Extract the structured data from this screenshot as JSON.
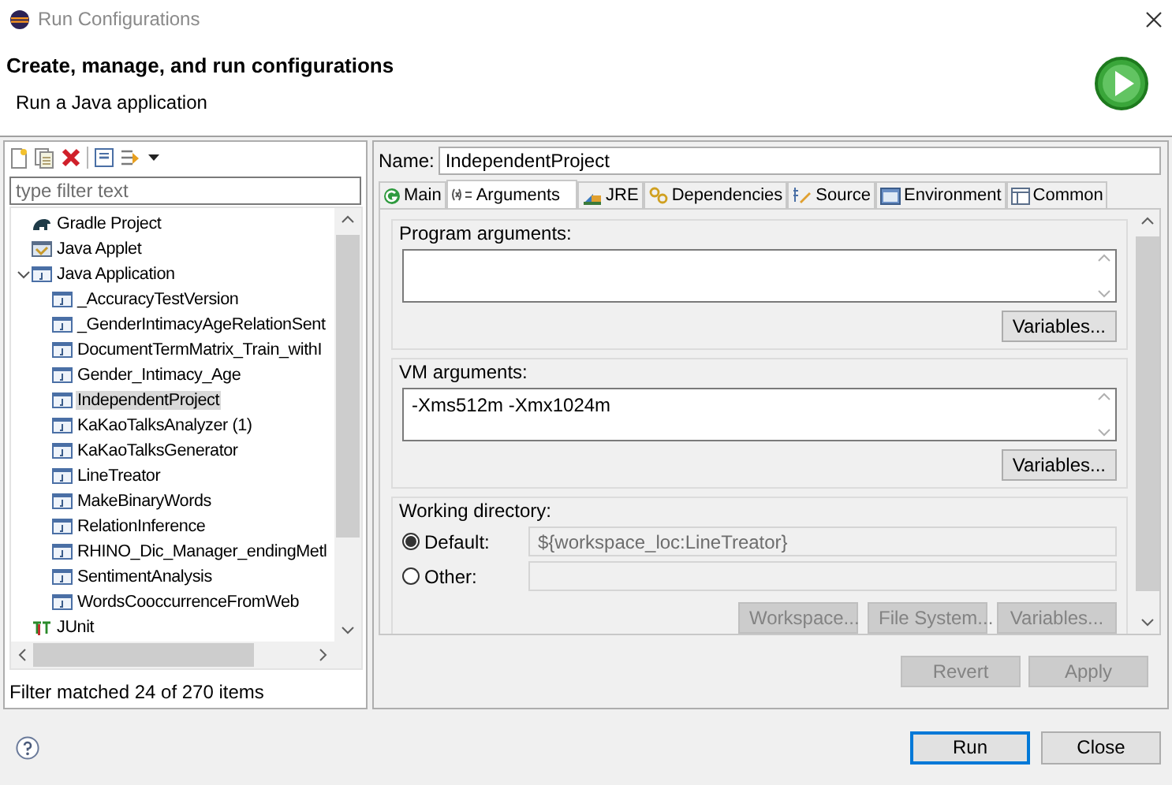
{
  "window": {
    "title": "Run Configurations"
  },
  "header": {
    "title": "Create, manage, and run configurations",
    "subtitle": "Run a Java application"
  },
  "sidebar": {
    "filter": {
      "placeholder": "type filter text"
    },
    "tree": [
      {
        "label": "Gradle Project",
        "kind": "gradle",
        "selected": false
      },
      {
        "label": "Java Applet",
        "kind": "applet",
        "selected": false
      },
      {
        "label": "Java Application",
        "kind": "application",
        "selected": false,
        "expanded": true,
        "children": [
          {
            "label": "_AccuracyTestVersion",
            "kind": "launch",
            "selected": false
          },
          {
            "label": "_GenderIntimacyAgeRelationSent",
            "kind": "launch",
            "selected": false
          },
          {
            "label": "DocumentTermMatrix_Train_withI",
            "kind": "launch",
            "selected": false
          },
          {
            "label": "Gender_Intimacy_Age",
            "kind": "launch",
            "selected": false
          },
          {
            "label": "IndependentProject",
            "kind": "launch",
            "selected": true
          },
          {
            "label": "KaKaoTalksAnalyzer (1)",
            "kind": "launch",
            "selected": false
          },
          {
            "label": "KaKaoTalksGenerator",
            "kind": "launch",
            "selected": false
          },
          {
            "label": "LineTreator",
            "kind": "launch",
            "selected": false
          },
          {
            "label": "MakeBinaryWords",
            "kind": "launch",
            "selected": false
          },
          {
            "label": "RelationInference",
            "kind": "launch",
            "selected": false
          },
          {
            "label": "RHINO_Dic_Manager_endingMetl",
            "kind": "launch",
            "selected": false
          },
          {
            "label": "SentimentAnalysis",
            "kind": "launch",
            "selected": false
          },
          {
            "label": "WordsCooccurrenceFromWeb",
            "kind": "launch",
            "selected": false
          }
        ]
      },
      {
        "label": "JUnit",
        "kind": "junit",
        "selected": false
      }
    ],
    "status": "Filter matched 24 of 270 items"
  },
  "editor": {
    "name_label": "Name:",
    "name": "IndependentProject",
    "tabs": [
      {
        "label": "Main",
        "selected": false
      },
      {
        "label": "Arguments",
        "selected": true
      },
      {
        "label": "JRE",
        "selected": false
      },
      {
        "label": "Dependencies",
        "selected": false
      },
      {
        "label": "Source",
        "selected": false
      },
      {
        "label": "Environment",
        "selected": false
      },
      {
        "label": "Common",
        "selected": false
      }
    ],
    "program_arguments": {
      "label": "Program arguments:",
      "button": "Variables..."
    },
    "vm_arguments": {
      "label": "VM arguments:",
      "value": "-Xms512m -Xmx1024m",
      "button": "Variables..."
    },
    "working_directory": {
      "label": "Working directory:",
      "options": [
        {
          "label": "Default:",
          "selected": true,
          "value": "${workspace_loc:LineTreator}",
          "disabled": true
        },
        {
          "label": "Other:",
          "selected": false,
          "disabled": true
        }
      ],
      "buttons": [
        {
          "label": "Workspace...",
          "disabled": true
        },
        {
          "label": "File System...",
          "disabled": true
        },
        {
          "label": "Variables...",
          "disabled": true
        }
      ]
    },
    "actions": [
      {
        "label": "Revert",
        "disabled": true
      },
      {
        "label": "Apply",
        "disabled": true
      }
    ]
  },
  "footer": {
    "buttons": [
      {
        "label": "Run",
        "default": true
      },
      {
        "label": "Close",
        "default": false
      }
    ]
  }
}
